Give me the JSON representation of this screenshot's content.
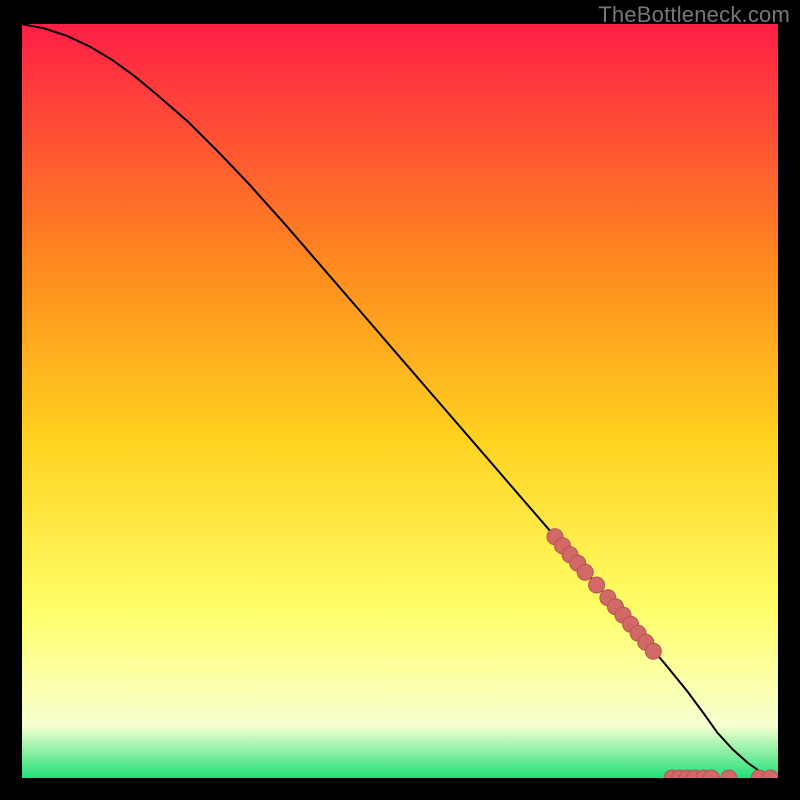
{
  "watermark": "TheBottleneck.com",
  "colors": {
    "gradient_top": "#ff1f46",
    "gradient_upper_mid": "#ff8a1f",
    "gradient_mid": "#ffd21f",
    "gradient_lower_mid": "#ffff6a",
    "gradient_near_bottom": "#f7ffd0",
    "gradient_bottom": "#22e07a",
    "curve": "#000000",
    "dot_fill": "#d16a66",
    "dot_stroke": "#b55550",
    "frame_bg": "#000000"
  },
  "chart_data": {
    "type": "line",
    "title": "",
    "xlabel": "",
    "ylabel": "",
    "xlim": [
      0,
      100
    ],
    "ylim": [
      0,
      100
    ],
    "series": [
      {
        "name": "bottleneck-curve",
        "x": [
          0,
          3,
          6,
          9,
          12,
          15,
          18,
          22,
          26,
          30,
          35,
          40,
          45,
          50,
          55,
          60,
          65,
          70,
          75,
          80,
          85,
          88,
          90,
          92,
          94,
          96,
          98,
          100
        ],
        "y": [
          100,
          99.4,
          98.4,
          97.0,
          95.2,
          93.0,
          90.5,
          87.0,
          83.0,
          78.8,
          73.2,
          67.4,
          61.6,
          55.8,
          50.0,
          44.2,
          38.4,
          32.6,
          26.8,
          21.0,
          15.2,
          11.5,
          8.8,
          6.0,
          3.8,
          2.0,
          0.6,
          0.0
        ]
      }
    ],
    "scatter_overlay": {
      "name": "highlighted-points",
      "points": [
        {
          "x": 70.5,
          "y": 32.0
        },
        {
          "x": 71.5,
          "y": 30.8
        },
        {
          "x": 72.5,
          "y": 29.6
        },
        {
          "x": 73.5,
          "y": 28.5
        },
        {
          "x": 74.5,
          "y": 27.3
        },
        {
          "x": 76.0,
          "y": 25.6
        },
        {
          "x": 77.5,
          "y": 23.9
        },
        {
          "x": 78.5,
          "y": 22.7
        },
        {
          "x": 79.5,
          "y": 21.6
        },
        {
          "x": 80.5,
          "y": 20.4
        },
        {
          "x": 81.5,
          "y": 19.2
        },
        {
          "x": 82.5,
          "y": 18.0
        },
        {
          "x": 83.5,
          "y": 16.8
        },
        {
          "x": 86.0,
          "y": 0.0
        },
        {
          "x": 87.0,
          "y": 0.0
        },
        {
          "x": 88.0,
          "y": 0.0
        },
        {
          "x": 89.0,
          "y": 0.0
        },
        {
          "x": 90.2,
          "y": 0.0
        },
        {
          "x": 91.2,
          "y": 0.0
        },
        {
          "x": 93.5,
          "y": 0.0
        },
        {
          "x": 97.5,
          "y": 0.0
        },
        {
          "x": 99.0,
          "y": 0.0
        }
      ]
    }
  }
}
